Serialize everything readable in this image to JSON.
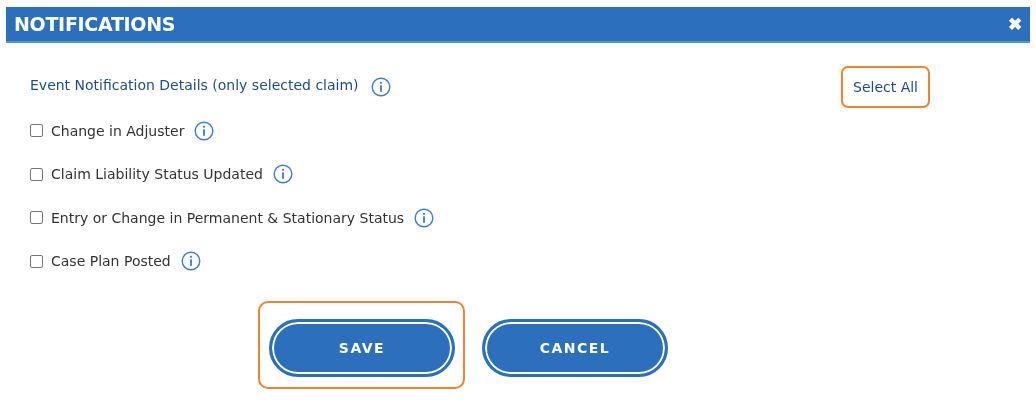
{
  "window": {
    "title": "NOTIFICATIONS",
    "close": "✖"
  },
  "section": {
    "heading": "Event Notification Details (only selected claim)",
    "select_all": {
      "label": "Select All",
      "highlighted": true
    }
  },
  "options": [
    {
      "label": "Change in Adjuster",
      "checked": false
    },
    {
      "label": "Claim Liability Status Updated",
      "checked": false
    },
    {
      "label": "Entry or Change in Permanent & Stationary Status",
      "checked": false
    },
    {
      "label": "Case Plan Posted",
      "checked": false
    }
  ],
  "buttons": [
    {
      "label": "SAVE",
      "highlighted": true
    },
    {
      "label": "CANCEL",
      "highlighted": false
    }
  ]
}
